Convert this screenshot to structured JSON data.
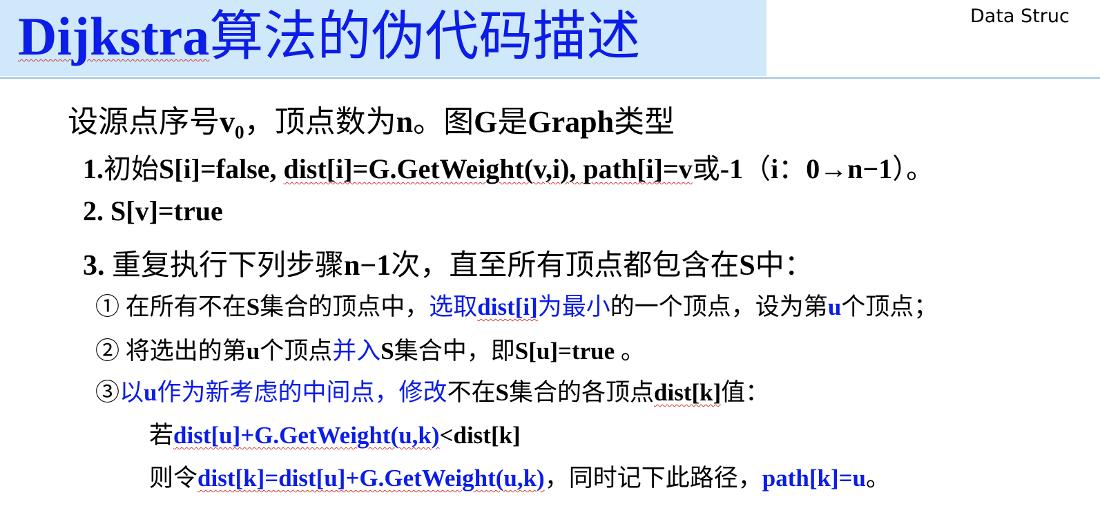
{
  "header": {
    "title_latin": "Dijkstra",
    "title_cn": "算法的伪代码描述",
    "corner_text": "Data  Struc"
  },
  "intro": {
    "t1": "设源点序号",
    "v": "v",
    "sub0": "0",
    "t2": "，顶点数为",
    "n": "n",
    "t3": "。图",
    "G": "G",
    "t4": "是",
    "Graph": "Graph",
    "t5": "类型"
  },
  "step1": {
    "num": "1.",
    "t1": "初始",
    "code1": "S[i]=false, ",
    "code2": "dist[i]=G.GetWeight(v,i), path[i]=v",
    "t2": "或",
    "code3": "-1",
    "t3": "（",
    "i": "i",
    "t4": "：",
    "range": "0→n−1",
    "t5": "）。"
  },
  "step2": {
    "num": "2. ",
    "code": "S[v]=true"
  },
  "step3": {
    "num": "3. ",
    "t1": "重复执行下列步骤",
    "code": "n−1",
    "t2": "次，直至所有顶点都包含在",
    "S": "S",
    "t3": "中："
  },
  "sub_a": {
    "mark": "① ",
    "t1": "在所有不在",
    "S": "S",
    "t2": "集合的顶点中，",
    "blue1": "选取",
    "blue_code": "dist[i]",
    "blue2": "为最小",
    "t3": "的一个顶点，设为第",
    "u": "u",
    "t4": "个顶点；"
  },
  "sub_b": {
    "mark": "② ",
    "t1": "将选出的第",
    "u": "u",
    "t2": "个顶点",
    "blue1": "并入",
    "S": "S",
    "t3": "集合中，即",
    "code": "S[u]=true",
    "t4": " 。"
  },
  "sub_c": {
    "mark": "③",
    "blue1": "以",
    "blue_u": "u",
    "blue2": "作为新考虑的中间点，修改",
    "t1": "不在",
    "S": "S",
    "t2": "集合的各顶点",
    "code": "dist[k]",
    "t3": "值："
  },
  "cond": {
    "t1": "若",
    "blue_code": "dist[u]+G.GetWeight(u,k)",
    "code": "<dist[k]"
  },
  "then": {
    "t1": "则令",
    "blue_code": "dist[k]=dist[u]+G.GetWeight(u,k)",
    "t2": "，同时记下此路径，",
    "blue_code2": "path[k]=u",
    "t3": "。"
  }
}
